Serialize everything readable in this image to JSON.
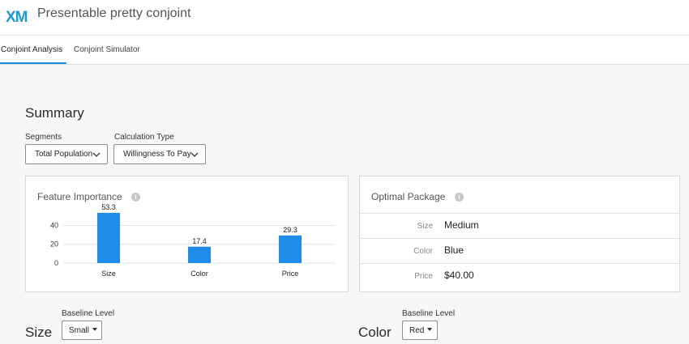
{
  "app": {
    "logo_text": "XM",
    "title": "Presentable pretty conjoint"
  },
  "tabs": [
    {
      "label": "Conjoint Analysis",
      "active": true
    },
    {
      "label": "Conjoint Simulator",
      "active": false
    }
  ],
  "summary": {
    "heading": "Summary",
    "segments": {
      "label": "Segments",
      "value": "Total Population"
    },
    "calculation_type": {
      "label": "Calculation Type",
      "value": "Willingness To Pay"
    }
  },
  "feature_importance": {
    "title": "Feature Importance",
    "info_icon": "info-icon"
  },
  "chart_data": {
    "type": "bar",
    "categories": [
      "Size",
      "Color",
      "Price"
    ],
    "values": [
      53.3,
      17.4,
      29.3
    ],
    "y_ticks": [
      0,
      20,
      40
    ],
    "ylim": [
      0,
      55
    ],
    "grid": true,
    "bar_color": "#1f8ceb"
  },
  "optimal_package": {
    "title": "Optimal Package",
    "rows": [
      {
        "label": "Size",
        "value": "Medium"
      },
      {
        "label": "Color",
        "value": "Blue"
      },
      {
        "label": "Price",
        "value": "$40.00"
      }
    ]
  },
  "attributes": [
    {
      "name": "Size",
      "baseline_label": "Baseline Level",
      "baseline_value": "Small"
    },
    {
      "name": "Color",
      "baseline_label": "Baseline Level",
      "baseline_value": "Red"
    }
  ],
  "colors": {
    "accent": "#1a8fd9",
    "logo_blue": "#1b9ad6",
    "bar": "#1f8ceb"
  }
}
